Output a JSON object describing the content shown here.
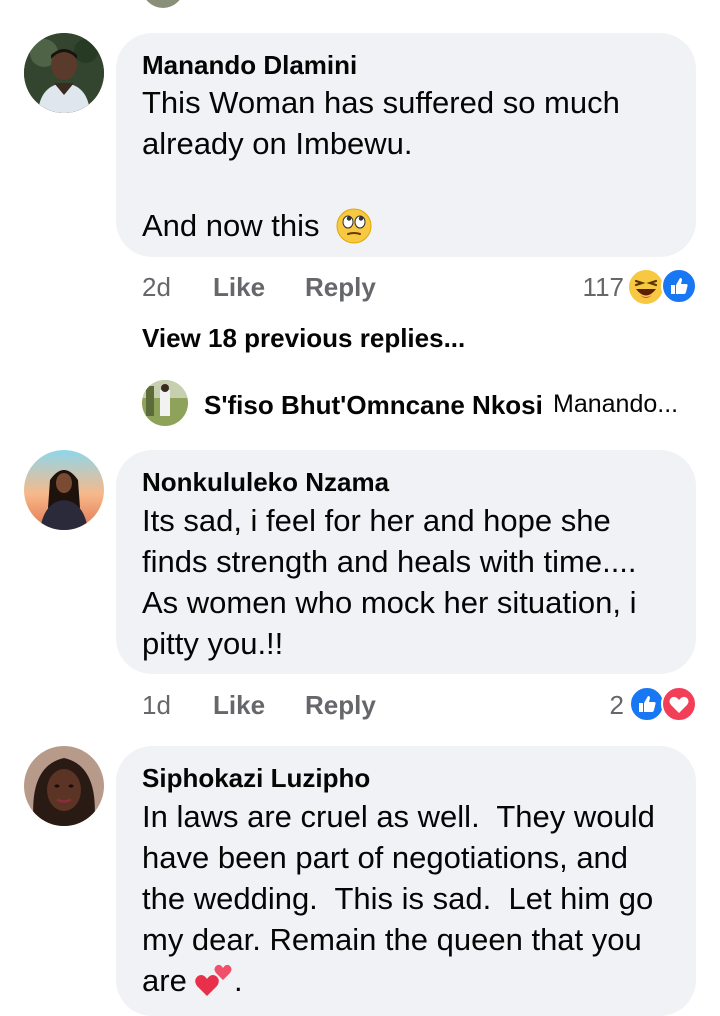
{
  "comments": [
    {
      "author": "Manando Dlamini",
      "lines": [
        "This Woman has suffered so much",
        "already on Imbewu.",
        "",
        "And now this"
      ],
      "time": "2d",
      "like_label": "Like",
      "reply_label": "Reply",
      "reaction_count": "117",
      "reactions": [
        "haha-icon",
        "like-icon"
      ],
      "trailing_emoji": "face-with-rolling-eyes-icon"
    },
    {
      "author": "Nonkululeko Nzama",
      "lines": [
        "Its sad, i feel for her and hope she",
        "finds strength and heals with time....",
        "As women who mock her situation, i",
        "pitty you.!!"
      ],
      "time": "1d",
      "like_label": "Like",
      "reply_label": "Reply",
      "reaction_count": "2",
      "reactions": [
        "like-icon",
        "love-icon"
      ]
    },
    {
      "author": "Siphokazi Luzipho",
      "lines": [
        "In laws are cruel as well.  They would",
        "have been part of negotiations, and",
        "the wedding.  This is sad.  Let him go",
        "my dear. Remain the queen that you",
        "are"
      ],
      "trailing_text": ".",
      "trailing_emoji": "two-hearts-icon"
    }
  ],
  "view_previous": "View 18 previous replies...",
  "reply_preview": {
    "author": "S'fiso Bhut'Omncane Nkosi",
    "snippet": "Manando..."
  },
  "colors": {
    "bubble": "#f0f2f5",
    "meta": "#65676b",
    "like_blue": "#1877f2",
    "love_red": "#f33e58",
    "emoji_yellow": "#f7c842"
  }
}
